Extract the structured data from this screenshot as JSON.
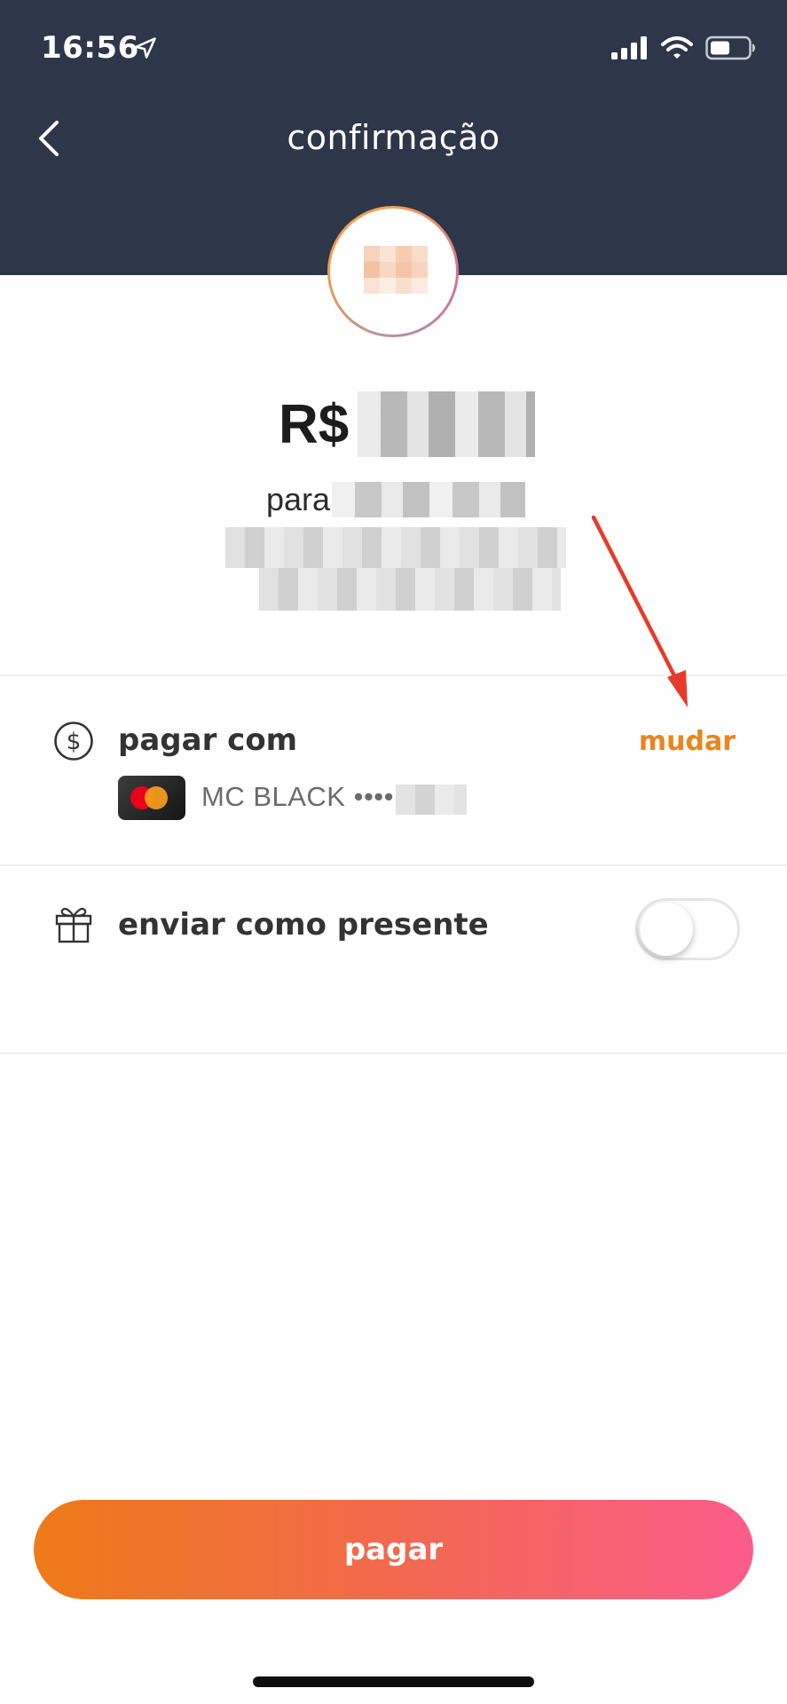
{
  "status_bar": {
    "time": "16:56",
    "icons": [
      "location-arrow-icon",
      "signal-bars-icon",
      "wifi-icon",
      "battery-icon"
    ]
  },
  "header": {
    "title": "confirmação",
    "back_icon": "chevron-left-icon"
  },
  "payment": {
    "currency": "R$",
    "recipient_prefix": "para"
  },
  "pay_with": {
    "icon": "dollar-circle-icon",
    "label": "pagar com",
    "change_label": "mudar",
    "card_brand_icon": "mastercard-icon",
    "card_text": "MC BLACK ••••"
  },
  "gift": {
    "icon": "gift-icon",
    "label": "enviar como presente",
    "toggle_on": false
  },
  "pay_button": {
    "label": "pagar"
  },
  "colors": {
    "header_bg": "#2e3649",
    "accent_orange": "#e8861f",
    "button_gradient_start": "#ef7a18",
    "button_gradient_end": "#fb5b8b",
    "annotation_arrow": "#e63b2a"
  }
}
